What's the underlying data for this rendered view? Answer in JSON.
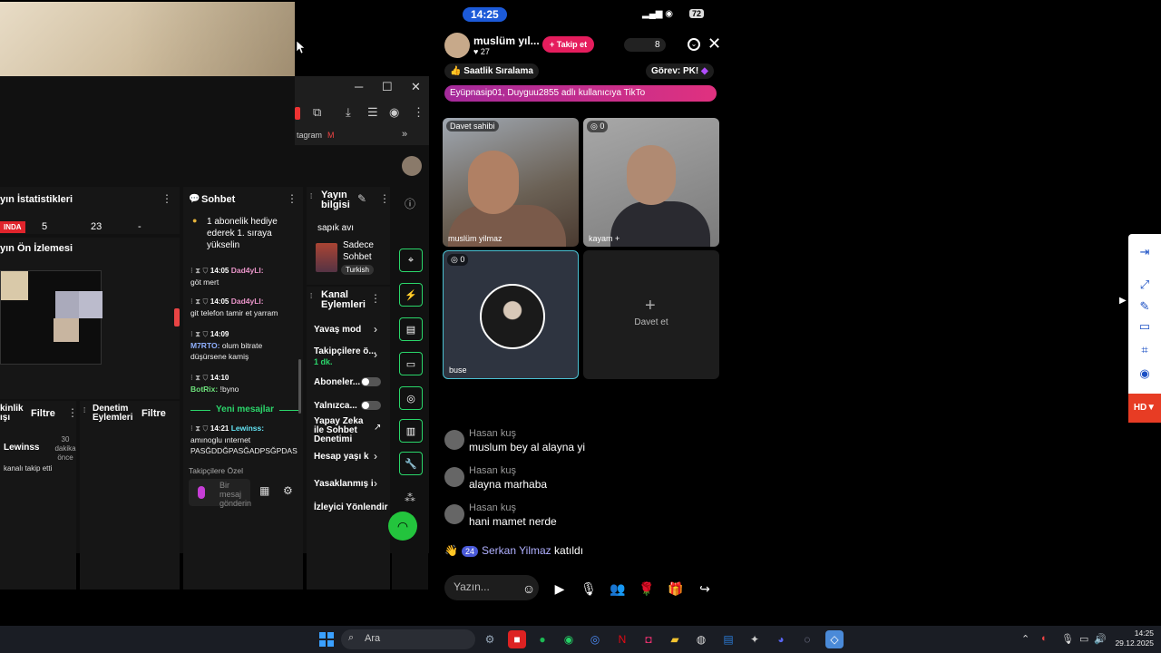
{
  "studio": {
    "stats_title": "yın İstatistikleri",
    "live_badge": "INDA",
    "stat1": "5",
    "stat2": "23",
    "stat3": "-",
    "preview_title": "yın Ön İzlemesi",
    "chat_title": "Sohbet",
    "info_title": "Yayın bilgisi",
    "stream_title": "sapık avı",
    "category": "Sadece Sohbet",
    "language": "Turkish",
    "channel_actions_title": "Kanal Eylemleri",
    "activity_title": "kinlik ışı",
    "activity_filter": "Filtre",
    "moderation_title": "Denetim Eylemleri",
    "moderation_filter": "Filtre",
    "activity_user": "Lewinss",
    "activity_time": "30 dakika önce",
    "activity_event": "kanalı takip etti",
    "bookmark": "tagram",
    "channel_rows": [
      "Yavaş mod",
      "Takipçilere ö...",
      "1 dk.",
      "Aboneler...",
      "Yalnızca...",
      "Yapay Zeka ile Sohbet Denetimi",
      "Hesap yaşı k",
      "Yasaklanmış i",
      "İzleyici Yönlendir"
    ],
    "new_messages": "Yeni mesajlar",
    "followers_only": "Takipçilere Özel",
    "chat_input_placeholder": "Bir mesaj gönderin",
    "pinned": "1 abonelik hediye ederek 1. sıraya yükselin",
    "messages": [
      {
        "time": "14:05",
        "user": "Dad4yLI:",
        "text": "göt mert"
      },
      {
        "time": "14:05",
        "user": "Dad4yLI:",
        "text": "git telefon tamir et yarram"
      },
      {
        "time": "14:09",
        "user": "M7RTO:",
        "text": "olum bitrate düşürsene kamiş"
      },
      {
        "time": "14:10",
        "user": "BotRix:",
        "text": "!byno"
      },
      {
        "time": "14:21",
        "user": "Lewinss:",
        "text": "amınoglu ınternet PASĞDDĞPASĞADPSĞPDAS"
      }
    ]
  },
  "phone": {
    "time": "14:25",
    "battery": "72",
    "host_name": "muslüm yıl...",
    "likes": "27",
    "follow": "Takip et",
    "viewers": "8",
    "ranking": "Saatlik Sıralama",
    "task": "Görev: PK!",
    "banner": "Eyüpnasip01, Duyguu2855 adlı kullanıcıya TikTo",
    "tiles": {
      "t1_tag": "Davet sahibi",
      "t1_name": "muslüm yilmaz",
      "t2_tag": "0",
      "t2_name": "kayam +",
      "t3_tag": "0",
      "t3_name": "buse",
      "t4_invite": "Davet et"
    },
    "comments": [
      {
        "user": "Hasan kuş",
        "text": "muslum bey al alayna yi"
      },
      {
        "user": "Hasan kuş",
        "text": "alayna marhaba"
      },
      {
        "user": "Hasan kuş",
        "text": "hani mamet nerde"
      }
    ],
    "join_badge": "24",
    "join_name": "Serkan Yilmaz",
    "join_text": "katıldı",
    "composer_placeholder": "Yazın..."
  },
  "sidetool": {
    "hd": "HD"
  },
  "taskbar": {
    "search": "Ara",
    "time": "14:25",
    "date": "29.12.2025"
  }
}
